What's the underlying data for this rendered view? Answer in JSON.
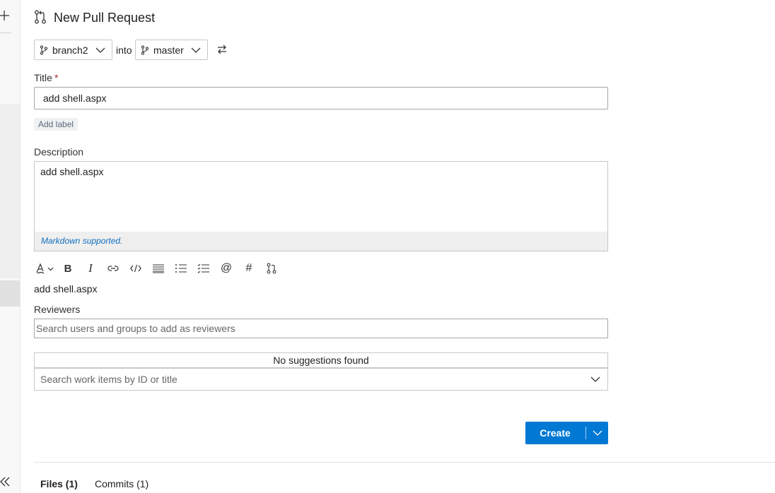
{
  "header": {
    "title": "New Pull Request"
  },
  "branches": {
    "source": "branch2",
    "into": "into",
    "target": "master"
  },
  "form": {
    "title_label": "Title",
    "title_required": "*",
    "title_value": "add shell.aspx",
    "add_label": "Add label",
    "description_label": "Description",
    "description_value": "add shell.aspx",
    "markdown_hint": "Markdown supported.",
    "preview_text": "add shell.aspx",
    "reviewers_label": "Reviewers",
    "reviewers_placeholder": "Search users and groups to add as reviewers",
    "suggestions_text": "No suggestions found",
    "workitems_placeholder": "Search work items by ID or title"
  },
  "toolbar": {
    "items": [
      "format-icon",
      "bold-icon",
      "italic-icon",
      "link-icon",
      "code-icon",
      "bulleted-list-icon",
      "numbered-list-icon",
      "checklist-icon",
      "mention-icon",
      "hashtag-icon",
      "pull-request-icon"
    ],
    "bold_glyph": "B",
    "italic_glyph": "I",
    "mention_glyph": "@",
    "hashtag_glyph": "#"
  },
  "actions": {
    "create_label": "Create"
  },
  "tabs": [
    {
      "label": "Files (1)",
      "active": true
    },
    {
      "label": "Commits (1)",
      "active": false
    }
  ],
  "colors": {
    "accent": "#0078d4",
    "required": "#a4262c",
    "link": "#106ebe"
  }
}
